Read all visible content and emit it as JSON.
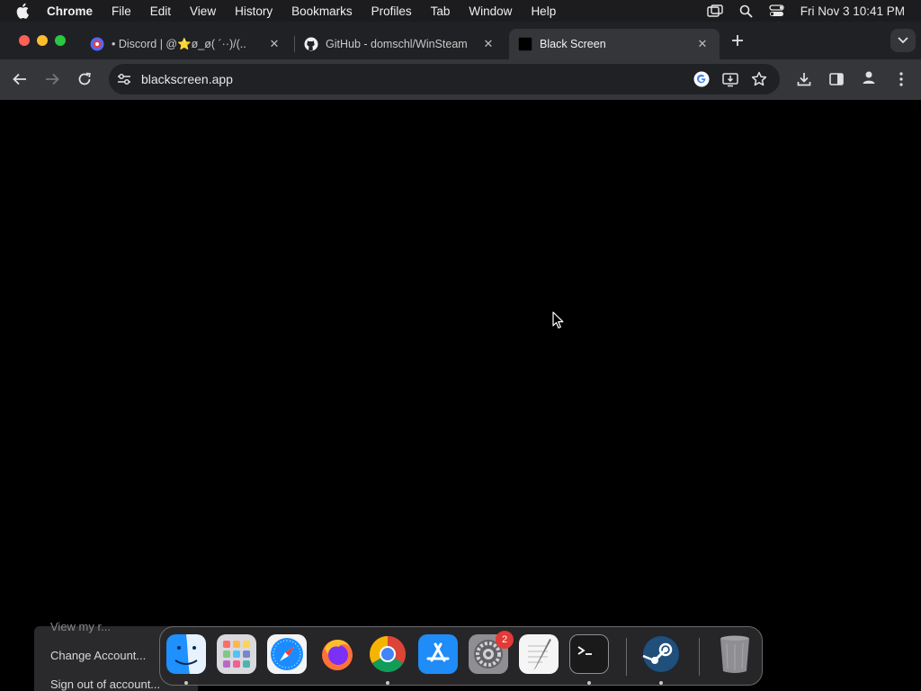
{
  "menubar": {
    "app_name": "Chrome",
    "items": [
      "File",
      "Edit",
      "View",
      "History",
      "Bookmarks",
      "Profiles",
      "Tab",
      "Window",
      "Help"
    ],
    "clock": "Fri Nov 3  10:41 PM"
  },
  "tabs": [
    {
      "title": "• Discord | @⭐ø_ø( ´··)/(..",
      "icon": "discord-icon"
    },
    {
      "title": "GitHub - domschl/WinSteam",
      "icon": "github-icon"
    },
    {
      "title": "Black Screen",
      "icon": "black-square-icon"
    }
  ],
  "toolbar": {
    "url": "blackscreen.app"
  },
  "background_menu": {
    "items": [
      "View my r...",
      "Change Account...",
      "Sign out of account..."
    ]
  },
  "dock": {
    "apps": [
      "Finder",
      "Launchpad",
      "Safari",
      "Firefox",
      "Chrome",
      "App Store",
      "System Settings",
      "TextEdit",
      "Terminal",
      "Steam",
      "Trash"
    ],
    "settings_badge": "2"
  },
  "colors": {
    "menubar": "#1c1c1e",
    "tabstrip": "#202124",
    "toolbar": "#35363a",
    "page": "#000000"
  }
}
